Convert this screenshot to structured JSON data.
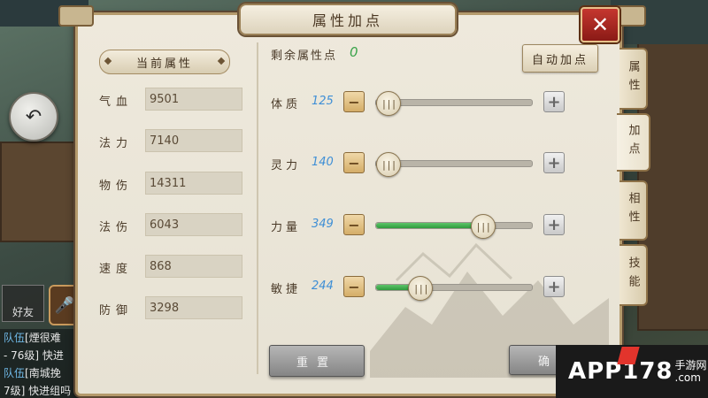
{
  "title": "属性加点",
  "left_panel": {
    "header": "当前属性",
    "attributes": [
      {
        "label": "气血",
        "value": "9501"
      },
      {
        "label": "法力",
        "value": "7140"
      },
      {
        "label": "物伤",
        "value": "14311"
      },
      {
        "label": "法伤",
        "value": "6043"
      },
      {
        "label": "速度",
        "value": "868"
      },
      {
        "label": "防御",
        "value": "3298"
      }
    ]
  },
  "right_panel": {
    "remaining_label": "剩余属性点",
    "remaining_value": "0",
    "auto_button": "自动加点",
    "sliders": [
      {
        "label": "体质",
        "value": "125",
        "level": 0.0
      },
      {
        "label": "灵力",
        "value": "140",
        "level": 0.0
      },
      {
        "label": "力量",
        "value": "349",
        "level": 0.68
      },
      {
        "label": "敏捷",
        "value": "244",
        "level": 0.28
      }
    ],
    "reset_button": "重置",
    "confirm_button": "确"
  },
  "side_tabs": [
    {
      "label": "属性",
      "active": false
    },
    {
      "label": "加点",
      "active": true
    },
    {
      "label": "相性",
      "active": false
    },
    {
      "label": "技能",
      "active": false
    }
  ],
  "hud": {
    "friend_button": "好友",
    "chat_lines": [
      {
        "channel": "队伍",
        "text": "[煙很难"
      },
      {
        "channel": "",
        "text": "- 76级] 快进"
      },
      {
        "channel": "队伍",
        "text": "[南城挽"
      },
      {
        "channel": "",
        "text": "7级] 快进组吗"
      }
    ]
  },
  "watermark": {
    "text": "APP178",
    "sub": "手游网",
    "sub2": ".com"
  },
  "colors": {
    "remaining": "#3aa34a",
    "slider_value": "#3f8fd6",
    "close": "#b02a24",
    "fill": "#3aa646"
  },
  "icons": {
    "close": "close-icon",
    "back": "back-arrow-icon",
    "mic": "microphone-icon"
  }
}
